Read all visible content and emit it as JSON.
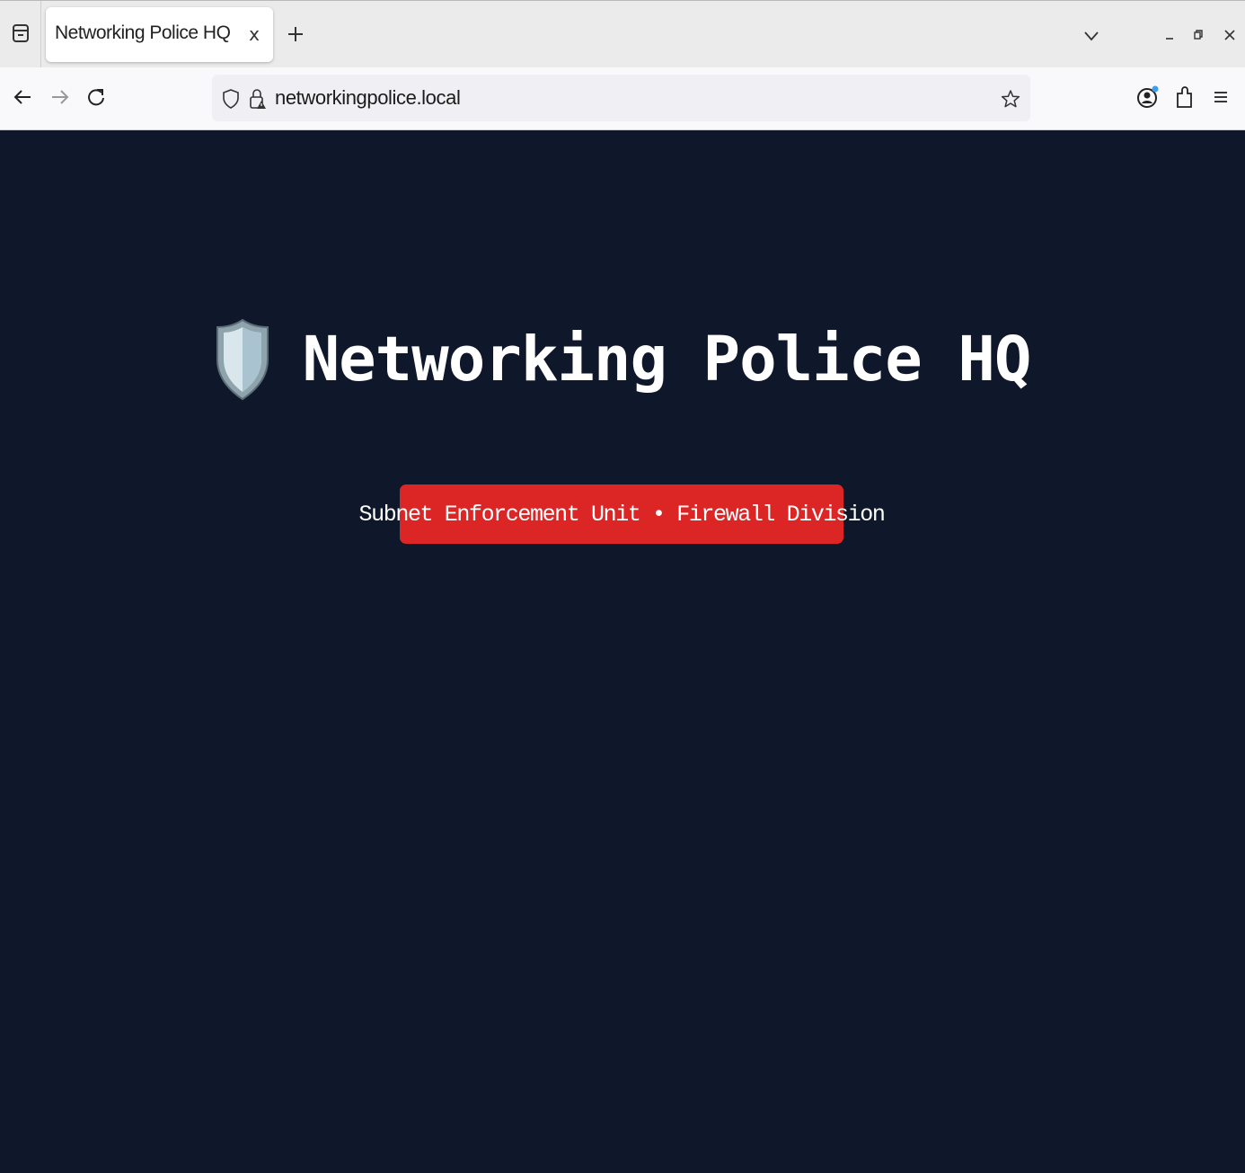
{
  "browser": {
    "tab": {
      "title": "Networking Police HQ",
      "close_label": "x"
    },
    "url": "networkingpolice.local"
  },
  "page": {
    "title": "Networking Police HQ",
    "badge": "Subnet Enforcement Unit • Firewall Division"
  },
  "colors": {
    "page_background": "#0f172a",
    "badge_background": "#dc2626",
    "title_text": "#ffffff"
  },
  "icons": [
    "tab-list-icon",
    "close-icon",
    "plus-icon",
    "chevron-down-icon",
    "minimize-icon",
    "restore-icon",
    "window-close-icon",
    "back-arrow-icon",
    "forward-arrow-icon",
    "reload-icon",
    "shield-icon",
    "lock-icon",
    "star-icon",
    "account-icon",
    "extensions-icon",
    "hamburger-menu-icon",
    "police-shield-icon"
  ]
}
